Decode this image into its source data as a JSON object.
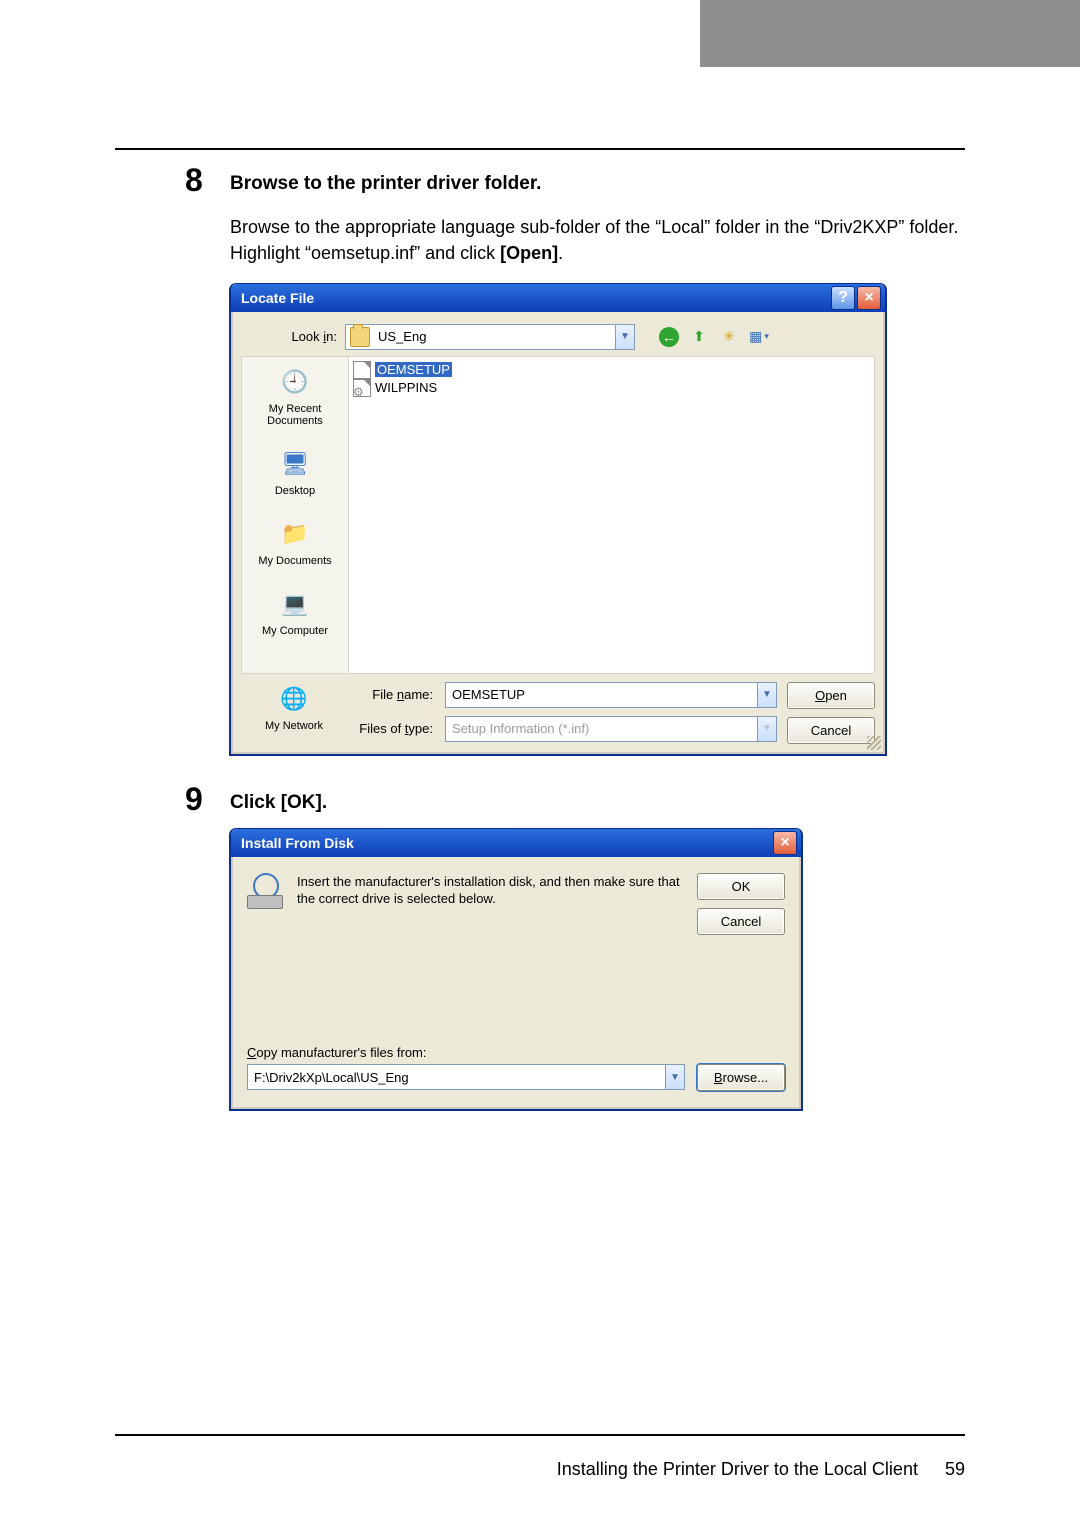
{
  "page": {
    "footer_section": "Installing the Printer Driver to the Local Client",
    "footer_page": "59"
  },
  "step8": {
    "num": "8",
    "title": "Browse to the printer driver folder.",
    "body_a": "Browse to the appropriate language sub-folder of the “Local” folder in the “Driv2KXP” folder. Highlight “oemsetup.inf” and click ",
    "body_b_bold": "[Open]",
    "body_c": "."
  },
  "locate": {
    "title": "Locate File",
    "lookin_label_pre": "Look ",
    "lookin_label_u": "i",
    "lookin_label_post": "n:",
    "lookin_value": "US_Eng",
    "toolbar": {
      "back": "back",
      "up": "up",
      "newfolder": "new-folder",
      "views": "views"
    },
    "places": {
      "recent": "My Recent Documents",
      "desktop": "Desktop",
      "mydocs": "My Documents",
      "mycomp": "My Computer",
      "mynet": "My Network"
    },
    "files": {
      "sel": "OEMSETUP",
      "other": "WILPPINS"
    },
    "filename_label_pre": "File ",
    "filename_label_u": "n",
    "filename_label_post": "ame:",
    "filename_value": "OEMSETUP",
    "filetype_label_pre": "Files of ",
    "filetype_label_u": "t",
    "filetype_label_post": "ype:",
    "filetype_value": "Setup Information (*.inf)",
    "open_u": "O",
    "open_rest": "pen",
    "cancel": "Cancel"
  },
  "step9": {
    "num": "9",
    "title": "Click [OK]."
  },
  "install": {
    "title": "Install From Disk",
    "msg": "Insert the manufacturer's installation disk, and then make sure that the correct drive is selected below.",
    "ok": "OK",
    "cancel": "Cancel",
    "copy_label_u": "C",
    "copy_label_rest": "opy manufacturer's files from:",
    "path": "F:\\Driv2kXp\\Local\\US_Eng",
    "browse_u": "B",
    "browse_rest": "rowse..."
  }
}
